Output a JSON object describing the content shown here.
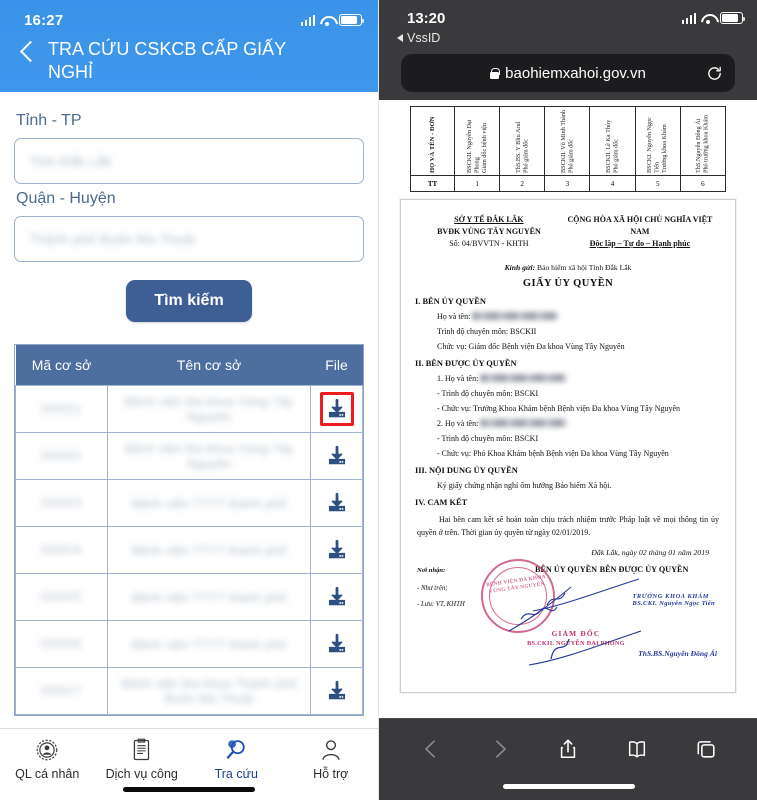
{
  "left_phone": {
    "status": {
      "time": "16:27",
      "signal_icon": "cellular-signal-icon",
      "wifi_icon": "wifi-icon",
      "battery_icon": "battery-icon"
    },
    "header": {
      "back_icon": "chevron-left-icon",
      "title": "TRA CỨU CSKCB CẤP GIẤY NGHỈ"
    },
    "form": {
      "province_label": "Tỉnh - TP",
      "province_value": "Tỉnh Đắk Lắk",
      "district_label": "Quận - Huyện",
      "district_value": "Thành phố Buôn Ma Thuột",
      "search_button": "Tìm kiếm"
    },
    "table": {
      "columns": [
        "Mã cơ sở",
        "Tên cơ sở",
        "File"
      ],
      "download_icon": "download-icon",
      "rows": [
        {
          "code": "00001",
          "name": "Bệnh viện Đa khoa Vùng Tây Nguyên",
          "highlighted": true
        },
        {
          "code": "00002",
          "name": "Bệnh viện Đa khoa Vùng Tây Nguyên",
          "highlighted": false
        },
        {
          "code": "00003",
          "name": "Bệnh viện TTYT thành phố",
          "highlighted": false
        },
        {
          "code": "00004",
          "name": "Bệnh viện TTYT thành phố",
          "highlighted": false
        },
        {
          "code": "00005",
          "name": "Bệnh viện TTYT thành phố",
          "highlighted": false
        },
        {
          "code": "00006",
          "name": "Bệnh viện TTYT thành phố",
          "highlighted": false
        },
        {
          "code": "00007",
          "name": "Bệnh viện Đa khoa Thành phố Buôn Ma Thuột",
          "highlighted": false
        }
      ]
    },
    "tabbar": [
      {
        "label": "QL cá nhân",
        "icon": "personal-management-icon",
        "active": false
      },
      {
        "label": "Dịch vụ công",
        "icon": "public-service-icon",
        "active": false
      },
      {
        "label": "Tra cứu",
        "icon": "search-lookup-icon",
        "active": true
      },
      {
        "label": "Hỗ trợ",
        "icon": "support-person-icon",
        "active": false
      }
    ]
  },
  "right_phone": {
    "status": {
      "time": "13:20",
      "back_app": "VssID",
      "signal_icon": "cellular-signal-icon",
      "wifi_icon": "wifi-icon",
      "battery_icon": "battery-icon"
    },
    "urlbar": {
      "lock_icon": "lock-icon",
      "url": "baohiemxahoi.gov.vn",
      "reload_icon": "reload-icon"
    },
    "rotated_table": {
      "header": "HỌ VÀ TÊN - ĐƠN",
      "row_label": "TT",
      "entries": [
        {
          "no": "1",
          "name": "BSCKII. Nguyễn Đại Phong",
          "role": "Giám đốc bệnh viện"
        },
        {
          "no": "2",
          "name": "ThS.BS. Y Bliu Arul",
          "role": "Phó giám đốc"
        },
        {
          "no": "3",
          "name": "BSCKII. Võ Minh Thành",
          "role": "Phó giám đốc"
        },
        {
          "no": "4",
          "name": "BSCKII. Lê Ka Thủy",
          "role": "Phó giám đốc"
        },
        {
          "no": "5",
          "name": "BSCKI. Nguyễn Ngọc Tiến",
          "role": "Trưởng khoa Khám"
        },
        {
          "no": "6",
          "name": "ThS.Nguyễn Đông Ái",
          "role": "Phó trưởng khoa Khám"
        }
      ]
    },
    "document": {
      "org_line1": "SỞ Y TẾ ĐẮK LẮK",
      "org_line2": "BVĐK VÙNG TÂY NGUYÊN",
      "org_line3": "Số: 04/BVVTN - KHTH",
      "nation_line1": "CỘNG HÒA XÃ HỘI CHỦ NGHĨA VIỆT NAM",
      "nation_line2": "Độc lập – Tự do – Hạnh phúc",
      "recipient_label": "Kính gửi:",
      "recipient": "Bảo hiểm xã hội Tỉnh Đắk Lắk",
      "title": "GIẤY ỦY QUYỀN",
      "sec1_title": "I. BÊN ỦY QUYỀN",
      "sec1_name_label": "Họ và tên:",
      "sec1_qual": "Trình độ chuyên môn: BSCKII",
      "sec1_pos": "Chức vụ: Giám đốc Bệnh viện Đa khoa Vùng Tây Nguyên",
      "sec2_title": "II. BÊN ĐƯỢC ỦY QUYỀN",
      "sec2_p1_name_label": "1. Họ và tên:",
      "sec2_p1_qual": "- Trình độ chuyên môn: BSCKI",
      "sec2_p1_pos": "- Chức vụ: Trưởng Khoa Khám bệnh Bệnh viện Đa khoa Vùng Tây Nguyên",
      "sec2_p2_name_label": "2. Họ và tên:",
      "sec2_p2_qual": "- Trình độ chuyên môn: BSCKI",
      "sec2_p2_pos": "- Chức vụ: Phó Khoa Khám bệnh Bệnh viện Đa khoa Vùng Tây Nguyên",
      "sec3_title": "III. NỘI DUNG ỦY QUYỀN",
      "sec3_body": "Ký giấy chứng nhận nghỉ ốm hưởng Bảo hiểm Xã hội.",
      "sec4_title": "IV. CAM KẾT",
      "sec4_body": "Hai bên cam kết sẽ hoàn toàn chịu trách nhiệm trước Pháp luật về mọi thông tin ủy quyền ở trên. Thời gian ủy quyền từ ngày 02/01/2019.",
      "dateline": "Đắk Lắk, ngày 02 tháng 01 năm 2019",
      "recipients_label": "Nơi nhận:",
      "recipients_1": "- Như trên;",
      "recipients_2": "- Lưu: VT, KHTH",
      "sig_left_title": "BÊN ỦY QUYỀN",
      "sig_right_title": "BÊN ĐƯỢC ỦY QUYỀN",
      "stamp_text": "BỆNH VIỆN\nĐA KHOA\nVÙNG\nTÂY NGUYÊN",
      "director_label": "GIÁM ĐỐC",
      "director_name": "BS.CKII. NGUYỄN ĐẠI PHONG",
      "sig_r1_title": "TRƯỞNG KHOA KHÁM",
      "sig_r1_name": "BS.CKI. Nguyễn Ngọc Tiến",
      "sig_r2_name": "ThS.BS.Nguyễn Đông Ái"
    },
    "toolbar": [
      {
        "icon": "back-chevron-icon",
        "dim": true
      },
      {
        "icon": "forward-chevron-icon",
        "dim": true
      },
      {
        "icon": "share-icon",
        "dim": false
      },
      {
        "icon": "bookmarks-book-icon",
        "dim": false
      },
      {
        "icon": "tabs-icon",
        "dim": false
      }
    ]
  },
  "colors": {
    "app_header_blue": "#3f97ec",
    "table_header_blue": "#4c6f9f",
    "button_blue": "#3d5f96",
    "highlight_red": "#ee1c1c",
    "safari_chrome": "#3a3a3c",
    "stamp_red": "#c2306a",
    "signature_blue": "#26389c"
  }
}
